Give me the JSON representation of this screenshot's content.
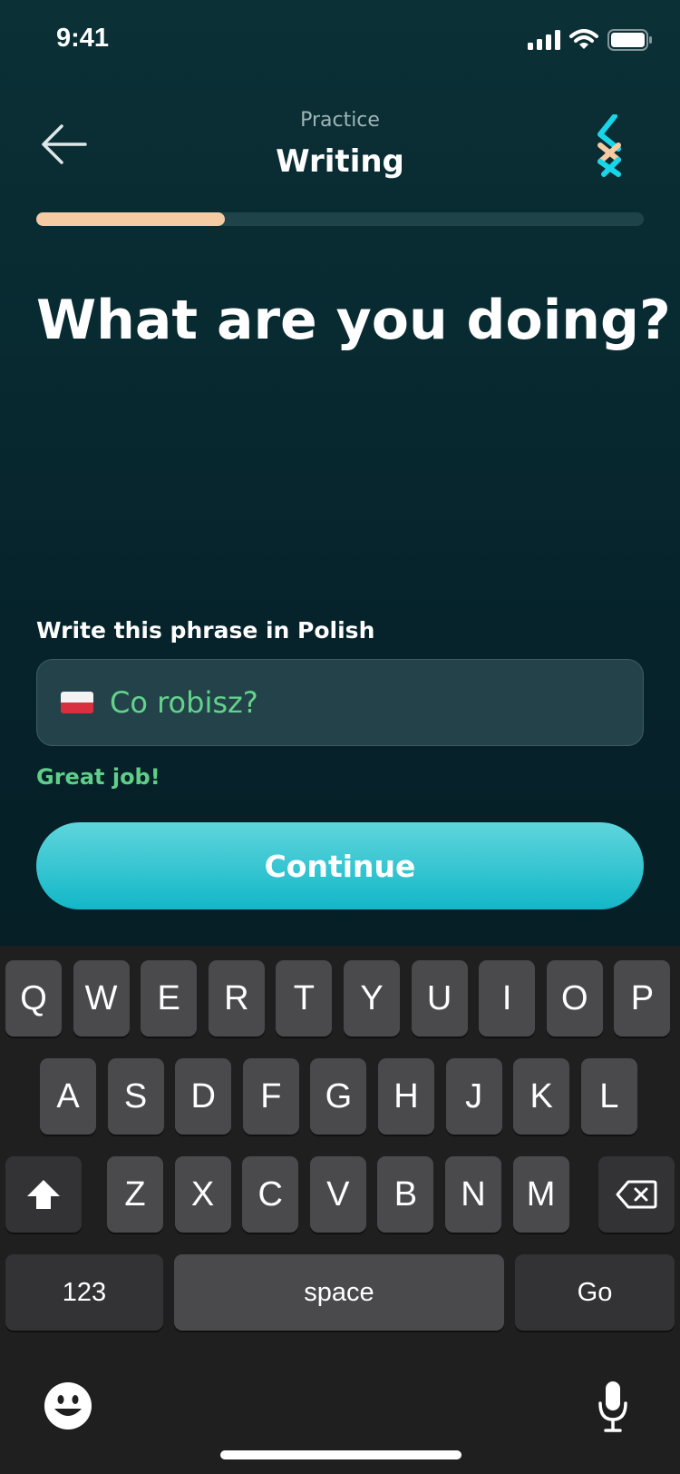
{
  "status_bar": {
    "time": "9:41",
    "icons": [
      "cellular-signal-icon",
      "wifi-icon",
      "battery-icon"
    ]
  },
  "header": {
    "back_icon": "arrow-left-icon",
    "subtitle": "Practice",
    "title": "Writing",
    "logo_icon": "app-logo-icon"
  },
  "progress": {
    "fraction": 0.31,
    "fill_color": "#f4cba3",
    "track_color": "#1e4449"
  },
  "exercise": {
    "question": "What are you doing?",
    "instruction": "Write this phrase in Polish",
    "flag_icon": "poland-flag-icon",
    "answer_value": "Co robisz?",
    "feedback": "Great job!",
    "continue_label": "Continue"
  },
  "colors": {
    "accent": "#12b7c8",
    "success": "#62d38b",
    "background": "#082a31"
  },
  "keyboard": {
    "row1": [
      "Q",
      "W",
      "E",
      "R",
      "T",
      "Y",
      "U",
      "I",
      "O",
      "P"
    ],
    "row2": [
      "A",
      "S",
      "D",
      "F",
      "G",
      "H",
      "J",
      "K",
      "L"
    ],
    "row3": [
      "Z",
      "X",
      "C",
      "V",
      "B",
      "N",
      "M"
    ],
    "shift_icon": "shift-arrow-icon",
    "delete_icon": "delete-backspace-icon",
    "numbers_label": "123",
    "space_label": "space",
    "go_label": "Go",
    "emoji_icon": "emoji-smiley-icon",
    "mic_icon": "microphone-icon"
  }
}
